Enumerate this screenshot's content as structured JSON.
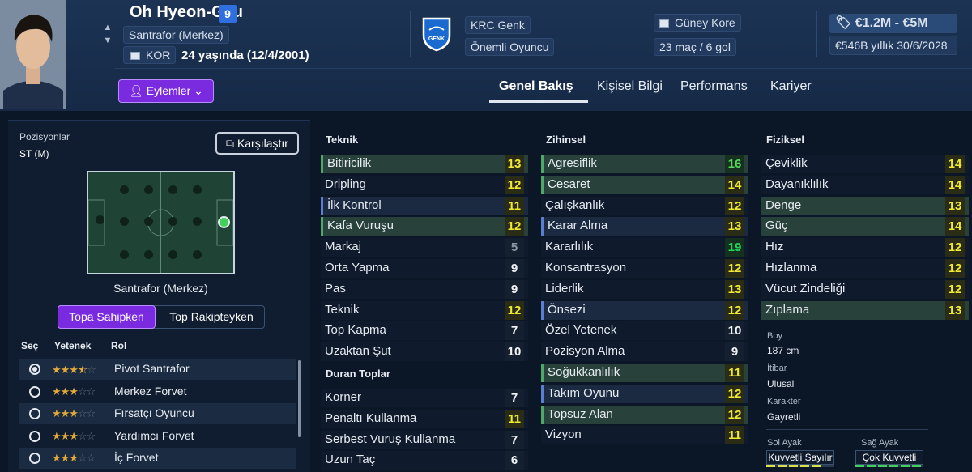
{
  "header": {
    "player_name": "Oh Hyeon-Gyu",
    "kit_number": "9",
    "position": "Santrafor (Merkez)",
    "nationality_code": "KOR",
    "age": "24 yaşında (12/4/2001)",
    "actions_label": "Eylemler",
    "club": "KRC Genk",
    "squad_status": "Önemli Oyuncu",
    "national_team": "Güney Kore",
    "intl_record": "23 maç / 6 gol",
    "value_range": "€1.2M - €5M",
    "contract": "€546B yıllık 30/6/2028"
  },
  "tabs": [
    "Genel Bakış",
    "Kişisel Bilgi",
    "Performans",
    "Kariyer"
  ],
  "positions_panel": {
    "title": "Pozisyonlar",
    "current": "ST (M)",
    "compare_label": "Karşılaştır",
    "position_name": "Santrafor (Merkez)",
    "toggle_on": "Topa Sahipken",
    "toggle_off": "Top Rakipteyken",
    "col_select": "Seç",
    "col_ability": "Yetenek",
    "col_role": "Rol"
  },
  "roles": [
    {
      "name": "Pivot Santrafor",
      "stars": 3.5,
      "selected": true
    },
    {
      "name": "Merkez Forvet",
      "stars": 3,
      "selected": false
    },
    {
      "name": "Fırsatçı Oyuncu",
      "stars": 3,
      "selected": false
    },
    {
      "name": "Yardımcı Forvet",
      "stars": 3,
      "selected": false
    },
    {
      "name": "İç Forvet",
      "stars": 3,
      "selected": false
    }
  ],
  "attributes": {
    "technical_title": "Teknik",
    "technical": [
      {
        "name": "Bitiricilik",
        "value": "13"
      },
      {
        "name": "Dripling",
        "value": "12"
      },
      {
        "name": "İlk Kontrol",
        "value": "11"
      },
      {
        "name": "Kafa Vuruşu",
        "value": "12"
      },
      {
        "name": "Markaj",
        "value": "5"
      },
      {
        "name": "Orta Yapma",
        "value": "9"
      },
      {
        "name": "Pas",
        "value": "9"
      },
      {
        "name": "Teknik",
        "value": "12"
      },
      {
        "name": "Top Kapma",
        "value": "7"
      },
      {
        "name": "Uzaktan Şut",
        "value": "10"
      }
    ],
    "setpieces_title": "Duran Toplar",
    "setpieces": [
      {
        "name": "Korner",
        "value": "7"
      },
      {
        "name": "Penaltı Kullanma",
        "value": "11"
      },
      {
        "name": "Serbest Vuruş Kullanma",
        "value": "7"
      },
      {
        "name": "Uzun Taç",
        "value": "6"
      }
    ],
    "mental_title": "Zihinsel",
    "mental": [
      {
        "name": "Agresiflik",
        "value": "16"
      },
      {
        "name": "Cesaret",
        "value": "14"
      },
      {
        "name": "Çalışkanlık",
        "value": "12"
      },
      {
        "name": "Karar Alma",
        "value": "13"
      },
      {
        "name": "Kararlılık",
        "value": "19"
      },
      {
        "name": "Konsantrasyon",
        "value": "12"
      },
      {
        "name": "Liderlik",
        "value": "13"
      },
      {
        "name": "Önsezi",
        "value": "12"
      },
      {
        "name": "Özel Yetenek",
        "value": "10"
      },
      {
        "name": "Pozisyon Alma",
        "value": "9"
      },
      {
        "name": "Soğukkanlılık",
        "value": "11"
      },
      {
        "name": "Takım Oyunu",
        "value": "12"
      },
      {
        "name": "Topsuz Alan",
        "value": "12"
      },
      {
        "name": "Vizyon",
        "value": "11"
      }
    ],
    "physical_title": "Fiziksel",
    "physical": [
      {
        "name": "Çeviklik",
        "value": "14"
      },
      {
        "name": "Dayanıklılık",
        "value": "14"
      },
      {
        "name": "Denge",
        "value": "13"
      },
      {
        "name": "Güç",
        "value": "14"
      },
      {
        "name": "Hız",
        "value": "12"
      },
      {
        "name": "Hızlanma",
        "value": "12"
      },
      {
        "name": "Vücut Zindeliği",
        "value": "12"
      },
      {
        "name": "Zıplama",
        "value": "13"
      }
    ]
  },
  "bio": {
    "height_label": "Boy",
    "height": "187 cm",
    "reputation_label": "İtibar",
    "reputation": "Ulusal",
    "personality_label": "Karakter",
    "personality": "Gayretli",
    "left_foot_label": "Sol Ayak",
    "left_foot": "Kuvvetli Sayılır",
    "left_foot_level": 0.8,
    "right_foot_label": "Sağ Ayak",
    "right_foot": "Çok Kuvvetli",
    "right_foot_level": 1.0
  },
  "colors": {
    "accent": "#7a2be0",
    "kit_badge": "#2f6fe0",
    "star": "#e0a93a",
    "pitch": "#1f4436",
    "selected_position": "#3fd15a"
  }
}
